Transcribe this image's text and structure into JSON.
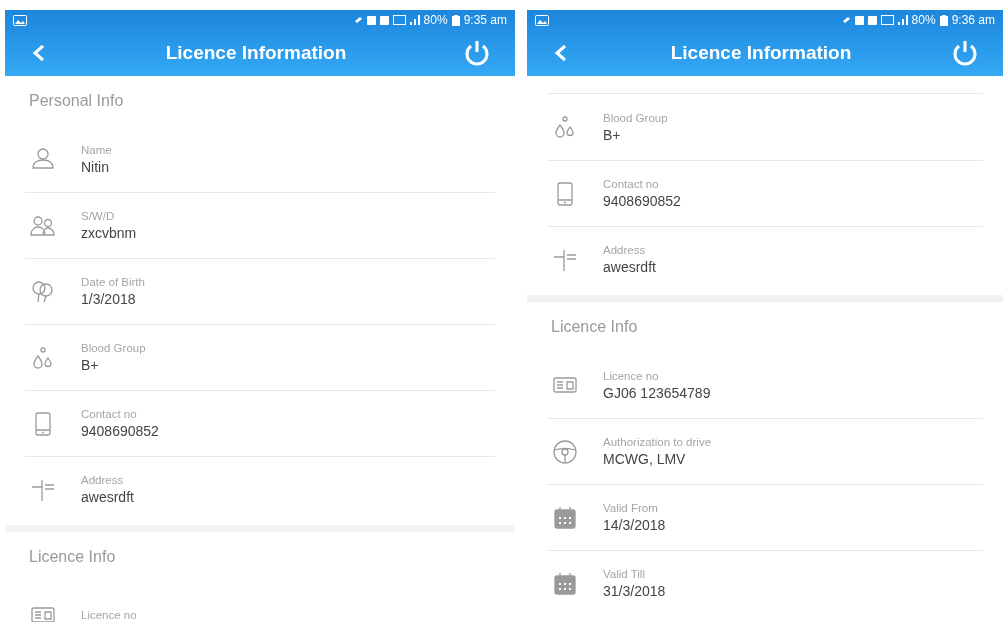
{
  "screens": [
    {
      "status_bar": {
        "battery": "80%",
        "time": "9:35 am"
      },
      "title": "Licence Information",
      "top_cut": false,
      "sections": [
        {
          "title": "Personal Info",
          "items": [
            {
              "kind": "person",
              "label": "Name",
              "value": "Nitin"
            },
            {
              "kind": "people",
              "label": "S/W/D",
              "value": "zxcvbnm"
            },
            {
              "kind": "balloons",
              "label": "Date of Birth",
              "value": "1/3/2018"
            },
            {
              "kind": "drops",
              "label": "Blood Group",
              "value": "B+"
            },
            {
              "kind": "phone",
              "label": "Contact no",
              "value": "9408690852"
            },
            {
              "kind": "signpost",
              "label": "Address",
              "value": "awesrdft"
            }
          ]
        },
        {
          "title": "Licence Info",
          "items": [
            {
              "kind": "card",
              "label": "Licence no"
            }
          ]
        }
      ]
    },
    {
      "status_bar": {
        "battery": "80%",
        "time": "9:36 am"
      },
      "title": "Licence Information",
      "top_cut": true,
      "sections": [
        {
          "items": [
            {
              "kind": "drops",
              "label": "Blood Group",
              "value": "B+"
            },
            {
              "kind": "phone",
              "label": "Contact no",
              "value": "9408690852"
            },
            {
              "kind": "signpost",
              "label": "Address",
              "value": "awesrdft"
            }
          ]
        },
        {
          "title": "Licence Info",
          "items": [
            {
              "kind": "card",
              "label": "Licence no",
              "value": "GJ06 123654789"
            },
            {
              "kind": "wheel",
              "label": "Authorization to drive",
              "value": "MCWG, LMV"
            },
            {
              "kind": "calendar",
              "label": "Valid From",
              "value": "14/3/2018"
            },
            {
              "kind": "calendar",
              "label": "Valid Till",
              "value": "31/3/2018"
            }
          ]
        }
      ]
    }
  ]
}
